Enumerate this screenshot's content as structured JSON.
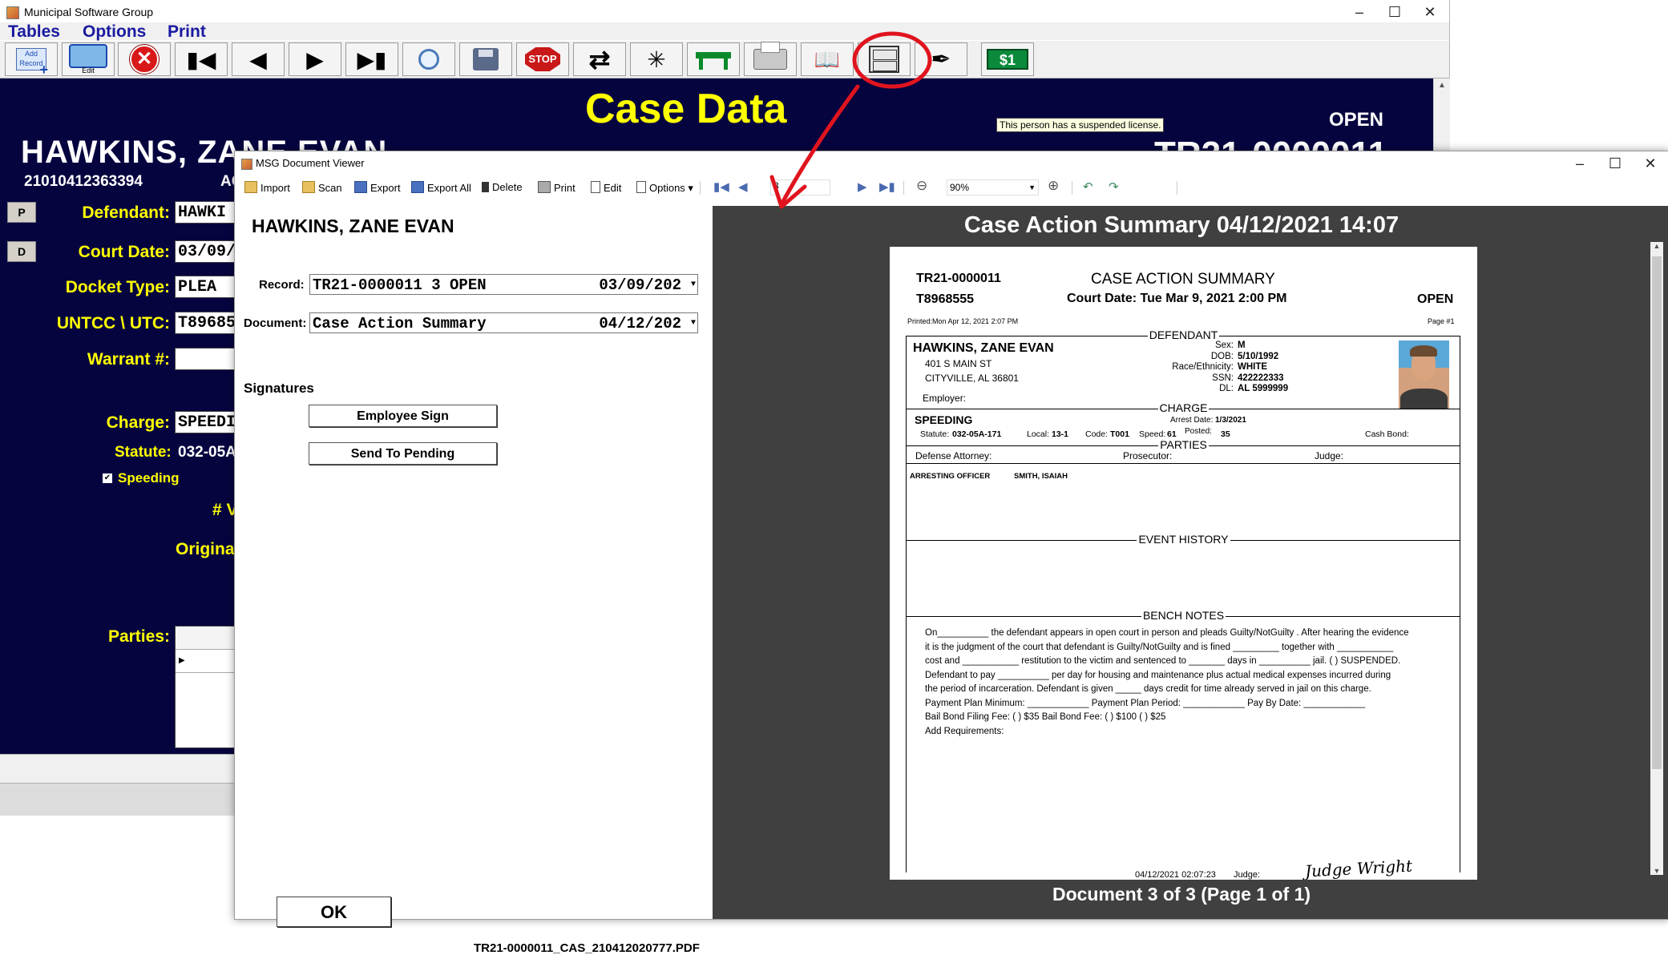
{
  "main_window": {
    "title": "Municipal Software Group",
    "menu": [
      "Tables",
      "Options",
      "Print"
    ],
    "toolbar": [
      {
        "name": "add-record",
        "label": "Add Record"
      },
      {
        "name": "edit",
        "label": "Edit"
      },
      {
        "name": "delete",
        "label": ""
      },
      {
        "name": "first-record",
        "label": ""
      },
      {
        "name": "previous-record",
        "label": ""
      },
      {
        "name": "next-record",
        "label": ""
      },
      {
        "name": "last-record",
        "label": ""
      },
      {
        "name": "search",
        "label": ""
      },
      {
        "name": "save",
        "label": ""
      },
      {
        "name": "stop",
        "label": "STOP"
      },
      {
        "name": "refresh",
        "label": ""
      },
      {
        "name": "network",
        "label": ""
      },
      {
        "name": "table",
        "label": ""
      },
      {
        "name": "printer",
        "label": ""
      },
      {
        "name": "book",
        "label": ""
      },
      {
        "name": "file-cabinet",
        "label": ""
      },
      {
        "name": "signature",
        "label": ""
      },
      {
        "name": "money",
        "label": "$1"
      }
    ],
    "case_data": {
      "heading": "Case Data",
      "status": "OPEN",
      "case_number": "TR21-0000011",
      "tooltip": "This person has a suspended license.",
      "defendant_name": "HAWKINS, ZANE EVAN",
      "defendant_id": "21010412363394",
      "id_suffix": "AC",
      "p_button": "P",
      "d_button": "D",
      "fields": [
        {
          "label": "Defendant:",
          "value": "HAWKI"
        },
        {
          "label": "Court Date:",
          "value": "03/09/2"
        },
        {
          "label": "Docket Type:",
          "value": "PLEA"
        },
        {
          "label": "UNTCC \\ UTC:",
          "value": "T89685"
        },
        {
          "label": "Warrant #:",
          "value": ""
        },
        {
          "label": "Charge:",
          "value": "SPEEDI"
        }
      ],
      "statute_label": "Statute:",
      "statute_value": "032-05A",
      "speeding_label": "Speeding",
      "v_label": "# V",
      "original_label": "Original",
      "parties_label": "Parties:"
    }
  },
  "viewer": {
    "title": "MSG Document Viewer",
    "toolbar": [
      "Import",
      "Scan",
      "Export",
      "Export All",
      "Delete",
      "Print",
      "Edit",
      "Options"
    ],
    "page_value": "3",
    "zoom": "90%",
    "defendant_name": "HAWKINS, ZANE EVAN",
    "record_label": "Record:",
    "record_value": "TR21-0000011 3 OPEN",
    "record_date": "03/09/202",
    "document_label": "Document:",
    "document_value": "Case Action Summary",
    "document_date": "04/12/202",
    "signatures_label": "Signatures",
    "employee_sign": "Employee Sign",
    "send_to_pending": "Send To Pending",
    "ok": "OK",
    "filename": "TR21-0000011_CAS_210412020777.PDF",
    "preview_header": "Case Action Summary   04/12/2021 14:07",
    "preview_footer": "Document 3 of 3 (Page 1 of 1)"
  },
  "document": {
    "case_no": "TR21-0000011",
    "ticket_no": "T8968555",
    "title": "CASE ACTION SUMMARY",
    "court_date": "Court Date:  Tue Mar 9, 2021 2:00 PM",
    "status": "OPEN",
    "printed": "Printed:Mon Apr 12, 2021 2:07 PM",
    "page_no": "Page #1",
    "defendant_section": "DEFENDANT",
    "name": "HAWKINS, ZANE EVAN",
    "address1": "401 S  MAIN ST",
    "address2": "CITYVILLE, AL  36801",
    "employer_label": "Employer:",
    "sex_label": "Sex:",
    "sex": "M",
    "dob_label": "DOB:",
    "dob": "5/10/1992",
    "race_label": "Race/Ethnicity:",
    "race": "WHITE",
    "ssn_label": "SSN:",
    "ssn": "422222333",
    "dl_label": "DL:",
    "dl": "AL 5999999",
    "charge_section": "CHARGE",
    "charge": "SPEEDING",
    "arrest_date_label": "Arrest Date:",
    "arrest_date": "1/3/2021",
    "statute_label": "Statute:",
    "statute": "032-05A-171",
    "local_label": "Local:",
    "local": "13-1",
    "code_label": "Code:",
    "code": "T001",
    "speed_label": "Speed:",
    "speed": "61",
    "posted_label": "Posted:",
    "posted": "35",
    "cash_bond_label": "Cash Bond:",
    "parties_section": "PARTIES",
    "defense_label": "Defense Attorney:",
    "prosecutor_label": "Prosecutor:",
    "judge_label": "Judge:",
    "officer_role": "ARRESTING OFFICER",
    "officer_name": "SMITH, ISAIAH",
    "event_section": "EVENT HISTORY",
    "bench_section": "BENCH NOTES",
    "bench_lines": [
      "On__________ the defendant appears in open court in person and pleads  Guilty/NotGuilty . After hearing the evidence",
      "it is the judgment of the court that defendant is  Guilty/NotGuilty  and is fined _________ together with ___________",
      "cost and ___________ restitution to the victim and sentenced to _______ days in __________ jail.  (   ) SUSPENDED.",
      "Defendant to pay __________ per day for housing and maintenance plus actual medical expenses incurred during",
      "the period of incarceration.  Defendant is given _____ days credit for time already served in jail on this charge.",
      "Payment Plan Minimum: ____________   Payment Plan Period: ____________   Pay By Date: ____________",
      "Bail Bond Filing Fee: (  ) $35   Bail Bond Fee: (  ) $100  (  ) $25",
      "Add Requirements:"
    ],
    "sign_timestamp": "04/12/2021 02:07:23",
    "judge_sig_label": "Judge:",
    "signature": "Judge Wright"
  },
  "colors": {
    "case_panel_bg": "#06043f",
    "label_yellow": "#ffff00",
    "menu_blue": "#1a1aa0",
    "preview_bg": "#404040",
    "annotation_red": "#e0141e"
  }
}
